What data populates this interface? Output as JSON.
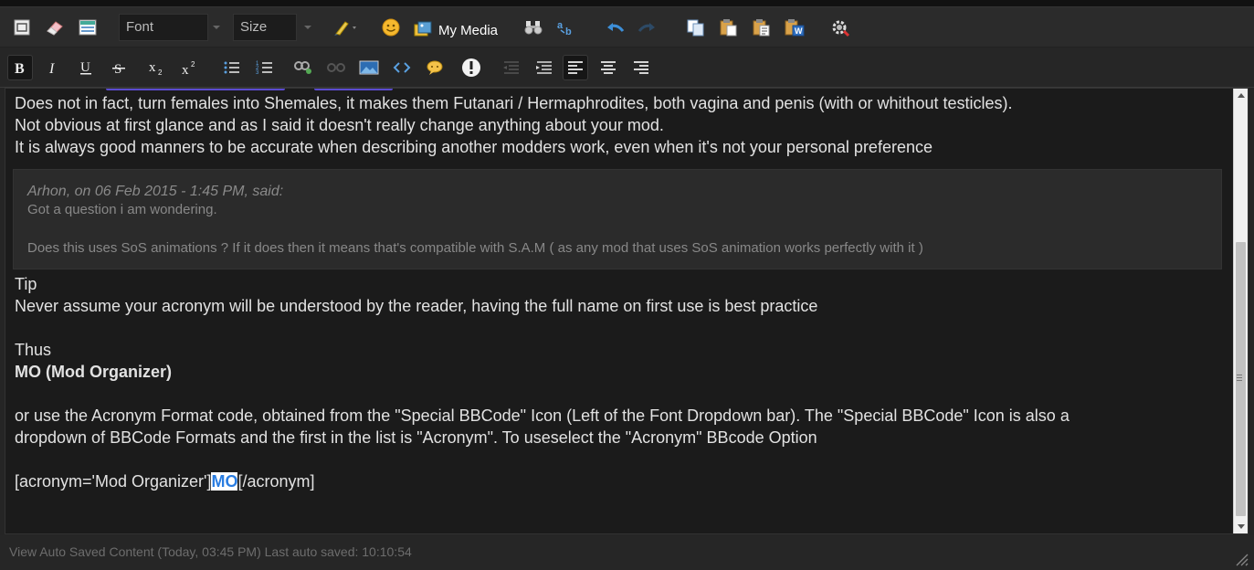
{
  "toolbar1": {
    "font_label": "Font",
    "size_label": "Size",
    "my_media_label": "My Media"
  },
  "editor": {
    "lines_top": [
      "Does not in fact, turn females into Shemales, it makes them Futanari / Hermaphrodites, both vagina and penis (with or whithout testicles).",
      "Not obvious at first glance and as I said it doesn't really change anything about your mod.",
      "It is always good manners to be accurate when describing another modders work, even when it's not your personal preference"
    ],
    "quote": {
      "cite": "Arhon, on 06 Feb 2015 - 1:45 PM, said:",
      "line1": "Got a question i am wondering.",
      "line2": "Does this uses SoS animations ? If it does then it means that's compatible with S.A.M ( as any mod that uses SoS animation works perfectly with it )"
    },
    "tip": "Tip",
    "tip_text": "Never assume your acronym will be understood by the reader, having the full name on first use is best practice",
    "thus": "Thus",
    "mo_bold": "MO (Mod Organizer)",
    "or_line1": "or use the Acronym Format code, obtained from the \"Special BBCode\" Icon (Left of the Font Dropdown bar). The \"Special BBCode\" Icon is also a",
    "or_line2": "dropdown of BBCode Formats and the first in the list is \"Acronym\". To useselect the \"Acronym\" BBcode Option",
    "code_open": "[acronym='Mod Organizer']",
    "code_selected": "MO",
    "code_close": "[/acronym]"
  },
  "status": {
    "text": "View Auto Saved Content (Today, 03:45 PM)  Last auto saved: 10:10:54"
  },
  "colors": {
    "accent": "#2a7de1",
    "background": "#1b1b1b"
  }
}
